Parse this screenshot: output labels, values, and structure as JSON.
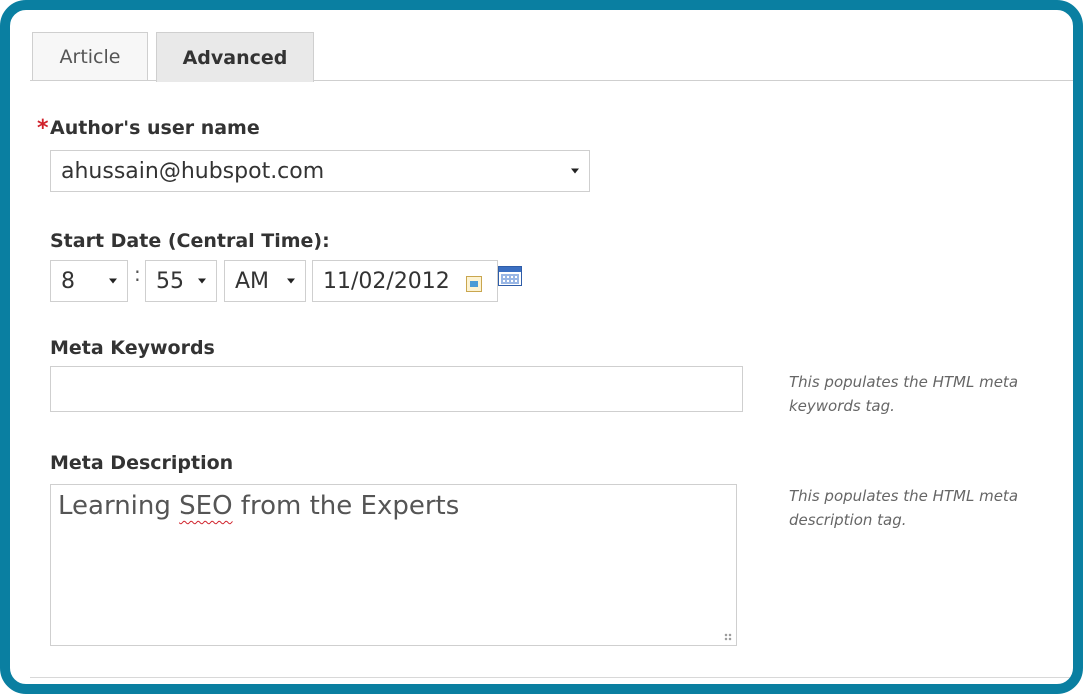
{
  "tabs": [
    {
      "label": "Article",
      "active": false
    },
    {
      "label": "Advanced",
      "active": true
    }
  ],
  "author": {
    "required_marker": "*",
    "label": "Author's user name",
    "value": "ahussain@hubspot.com"
  },
  "start_date": {
    "label": "Start Date (Central Time):",
    "hour": "8",
    "separator": ":",
    "minute": "55",
    "ampm": "AM",
    "date": "11/02/2012"
  },
  "meta_keywords": {
    "label": "Meta Keywords",
    "value": "",
    "hint": "This populates the HTML meta keywords tag."
  },
  "meta_description": {
    "label": "Meta Description",
    "value_pre": "Learning ",
    "value_underlined": "SEO",
    "value_post": " from the Experts",
    "hint": "This populates the HTML meta description tag."
  },
  "colors": {
    "frame_border": "#0a7fa1",
    "required_star": "#d0212b"
  },
  "icons": [
    "caret-down-icon",
    "date-picker-icon",
    "calendar-icon",
    "resize-grip-icon"
  ]
}
